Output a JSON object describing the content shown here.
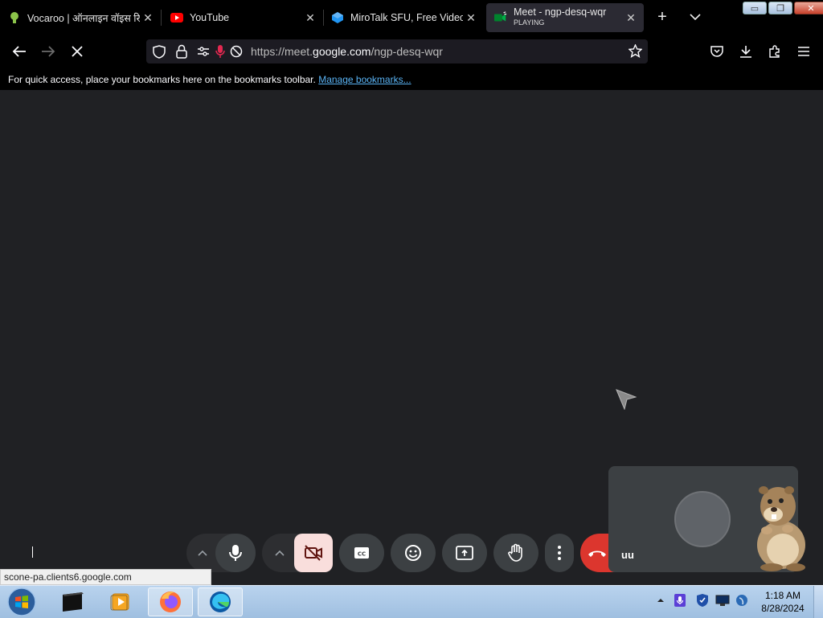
{
  "browser": {
    "tabs": [
      {
        "title": "Vocaroo | ऑनलाइन वॉइस रि",
        "favicon": "vocaroo-icon",
        "active": false
      },
      {
        "title": "YouTube",
        "favicon": "youtube-icon",
        "active": false
      },
      {
        "title": "MiroTalk SFU, Free Video C",
        "favicon": "mirotalk-icon",
        "active": false
      },
      {
        "title": "Meet - ngp-desq-wqr",
        "subtitle": "PLAYING",
        "favicon": "meet-icon",
        "active": true
      }
    ],
    "close_glyph": "✕",
    "new_tab_glyph": "+",
    "window_buttons": {
      "minimize": "▭",
      "restore": "❐",
      "close": "✕"
    }
  },
  "navbar": {
    "url_prefix": "https://meet.",
    "url_host": "google.com",
    "url_path": "/ngp-desq-wqr"
  },
  "bookmarks": {
    "message": "For quick access, place your bookmarks here on the bookmarks toolbar.",
    "link": "Manage bookmarks..."
  },
  "meet": {
    "self_name": "uu",
    "controls": [
      "mic-options",
      "mic",
      "camera-options",
      "camera-off",
      "captions",
      "emoji",
      "present",
      "raise-hand",
      "more-options",
      "leave-call"
    ],
    "colors": {
      "end_call": "#dc362e",
      "camera_off_bg": "#f9dedc",
      "button_bg": "#3c4043"
    }
  },
  "status_url": "scone-pa.clients6.google.com",
  "taskbar": {
    "time": "1:18 AM",
    "date": "8/28/2024"
  }
}
